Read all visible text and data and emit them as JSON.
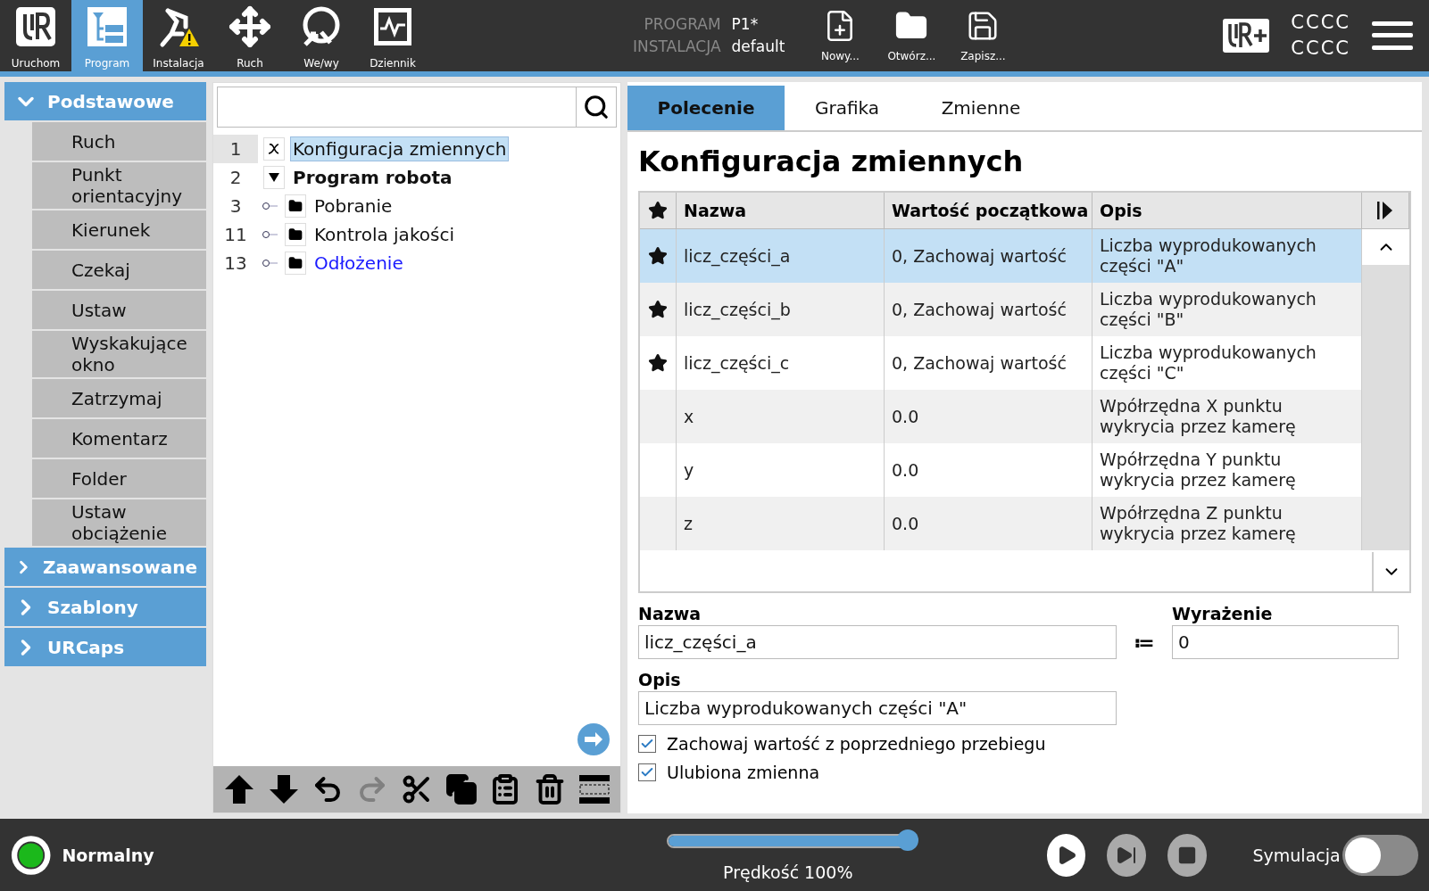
{
  "header": {
    "nav_tabs": [
      {
        "label": "Uruchom",
        "kind": "logo",
        "selected": false
      },
      {
        "label": "Program",
        "kind": "program",
        "selected": true
      },
      {
        "label": "Instalacja",
        "kind": "install",
        "selected": false
      },
      {
        "label": "Ruch",
        "kind": "move",
        "selected": false
      },
      {
        "label": "We/wy",
        "kind": "io",
        "selected": false
      },
      {
        "label": "Dziennik",
        "kind": "log",
        "selected": false
      }
    ],
    "program_label": "PROGRAM",
    "program_value": "P1*",
    "installation_label": "INSTALACJA",
    "installation_value": "default",
    "file_buttons": [
      {
        "label": "Nowy...",
        "kind": "new"
      },
      {
        "label": "Otwórz...",
        "kind": "open"
      },
      {
        "label": "Zapisz...",
        "kind": "save"
      }
    ],
    "user_lines": [
      "CCCC",
      "CCCC"
    ]
  },
  "sidebar": {
    "categories": [
      {
        "label": "Podstawowe",
        "expanded": true,
        "items": [
          "Ruch",
          "Punkt orientacyjny",
          "Kierunek",
          "Czekaj",
          "Ustaw",
          "Wyskakujące okno",
          "Zatrzymaj",
          "Komentarz",
          "Folder",
          "Ustaw obciążenie"
        ]
      },
      {
        "label": "Zaawansowane",
        "expanded": false
      },
      {
        "label": "Szablony",
        "expanded": false
      },
      {
        "label": "URCaps",
        "expanded": false
      }
    ]
  },
  "tree": {
    "rows": [
      {
        "number": "1",
        "label": "Konfiguracja zmiennych",
        "kind": "variables",
        "selected": true,
        "current": false
      },
      {
        "number": "2",
        "label": "Program robota",
        "kind": "root",
        "selected": false,
        "current": false,
        "expanded": true,
        "children": [
          {
            "number": "3",
            "label": "Pobranie",
            "kind": "folder",
            "selected": false,
            "current": false
          },
          {
            "number": "11",
            "label": "Kontrola jakości",
            "kind": "folder",
            "selected": false,
            "current": false
          },
          {
            "number": "13",
            "label": "Odłożenie",
            "kind": "folder",
            "selected": false,
            "current": true
          }
        ]
      }
    ],
    "tools": [
      {
        "kind": "up",
        "disabled": false
      },
      {
        "kind": "down",
        "disabled": false
      },
      {
        "kind": "undo",
        "disabled": false
      },
      {
        "kind": "redo",
        "disabled": true
      },
      {
        "kind": "cut",
        "disabled": false
      },
      {
        "kind": "copy",
        "disabled": false
      },
      {
        "kind": "paste",
        "disabled": false
      },
      {
        "kind": "delete",
        "disabled": false
      },
      {
        "kind": "suppress",
        "disabled": false
      }
    ]
  },
  "panel": {
    "tabs": [
      {
        "label": "Polecenie",
        "selected": true
      },
      {
        "label": "Grafika",
        "selected": false
      },
      {
        "label": "Zmienne",
        "selected": false
      }
    ],
    "title": "Konfiguracja zmiennych",
    "table": {
      "columns": [
        "Nazwa",
        "Wartość początkowa",
        "Opis"
      ],
      "rows": [
        {
          "favorite": true,
          "name": "licz_części_a",
          "initial": "0, Zachowaj wartość",
          "description": "Liczba wyprodukowanych części \"A\"",
          "selected": true
        },
        {
          "favorite": true,
          "name": "licz_części_b",
          "initial": "0, Zachowaj wartość",
          "description": "Liczba wyprodukowanych części \"B\"",
          "selected": false
        },
        {
          "favorite": true,
          "name": "licz_części_c",
          "initial": "0, Zachowaj wartość",
          "description": "Liczba wyprodukowanych części \"C\"",
          "selected": false
        },
        {
          "favorite": false,
          "name": "x",
          "initial": "0.0",
          "description": "Wpółrzędna X punktu wykrycia przez kamerę",
          "selected": false
        },
        {
          "favorite": false,
          "name": "y",
          "initial": "0.0",
          "description": "Wpółrzędna Y punktu wykrycia przez kamerę",
          "selected": false
        },
        {
          "favorite": false,
          "name": "z",
          "initial": "0.0",
          "description": "Wpółrzędna Z punktu wykrycia przez kamerę",
          "selected": false
        }
      ]
    },
    "name_label": "Nazwa",
    "name_value": "licz_części_a",
    "assign": "≔",
    "expression_label": "Wyrażenie",
    "expression_value": "0",
    "description_label": "Opis",
    "description_value": "Liczba wyprodukowanych części \"A\"",
    "checkboxes": [
      {
        "label": "Zachowaj wartość z poprzedniego przebiegu",
        "checked": true
      },
      {
        "label": "Ulubiona zmienna",
        "checked": true
      }
    ]
  },
  "footer": {
    "status": "Normalny",
    "speed": {
      "level": 1.0,
      "reading": "Prędkość 100%"
    },
    "controls": [
      {
        "kind": "play",
        "disabled": false
      },
      {
        "kind": "step",
        "disabled": true
      },
      {
        "kind": "stop",
        "disabled": true
      }
    ],
    "simulation": {
      "label": "Symulacja",
      "on": false
    }
  }
}
